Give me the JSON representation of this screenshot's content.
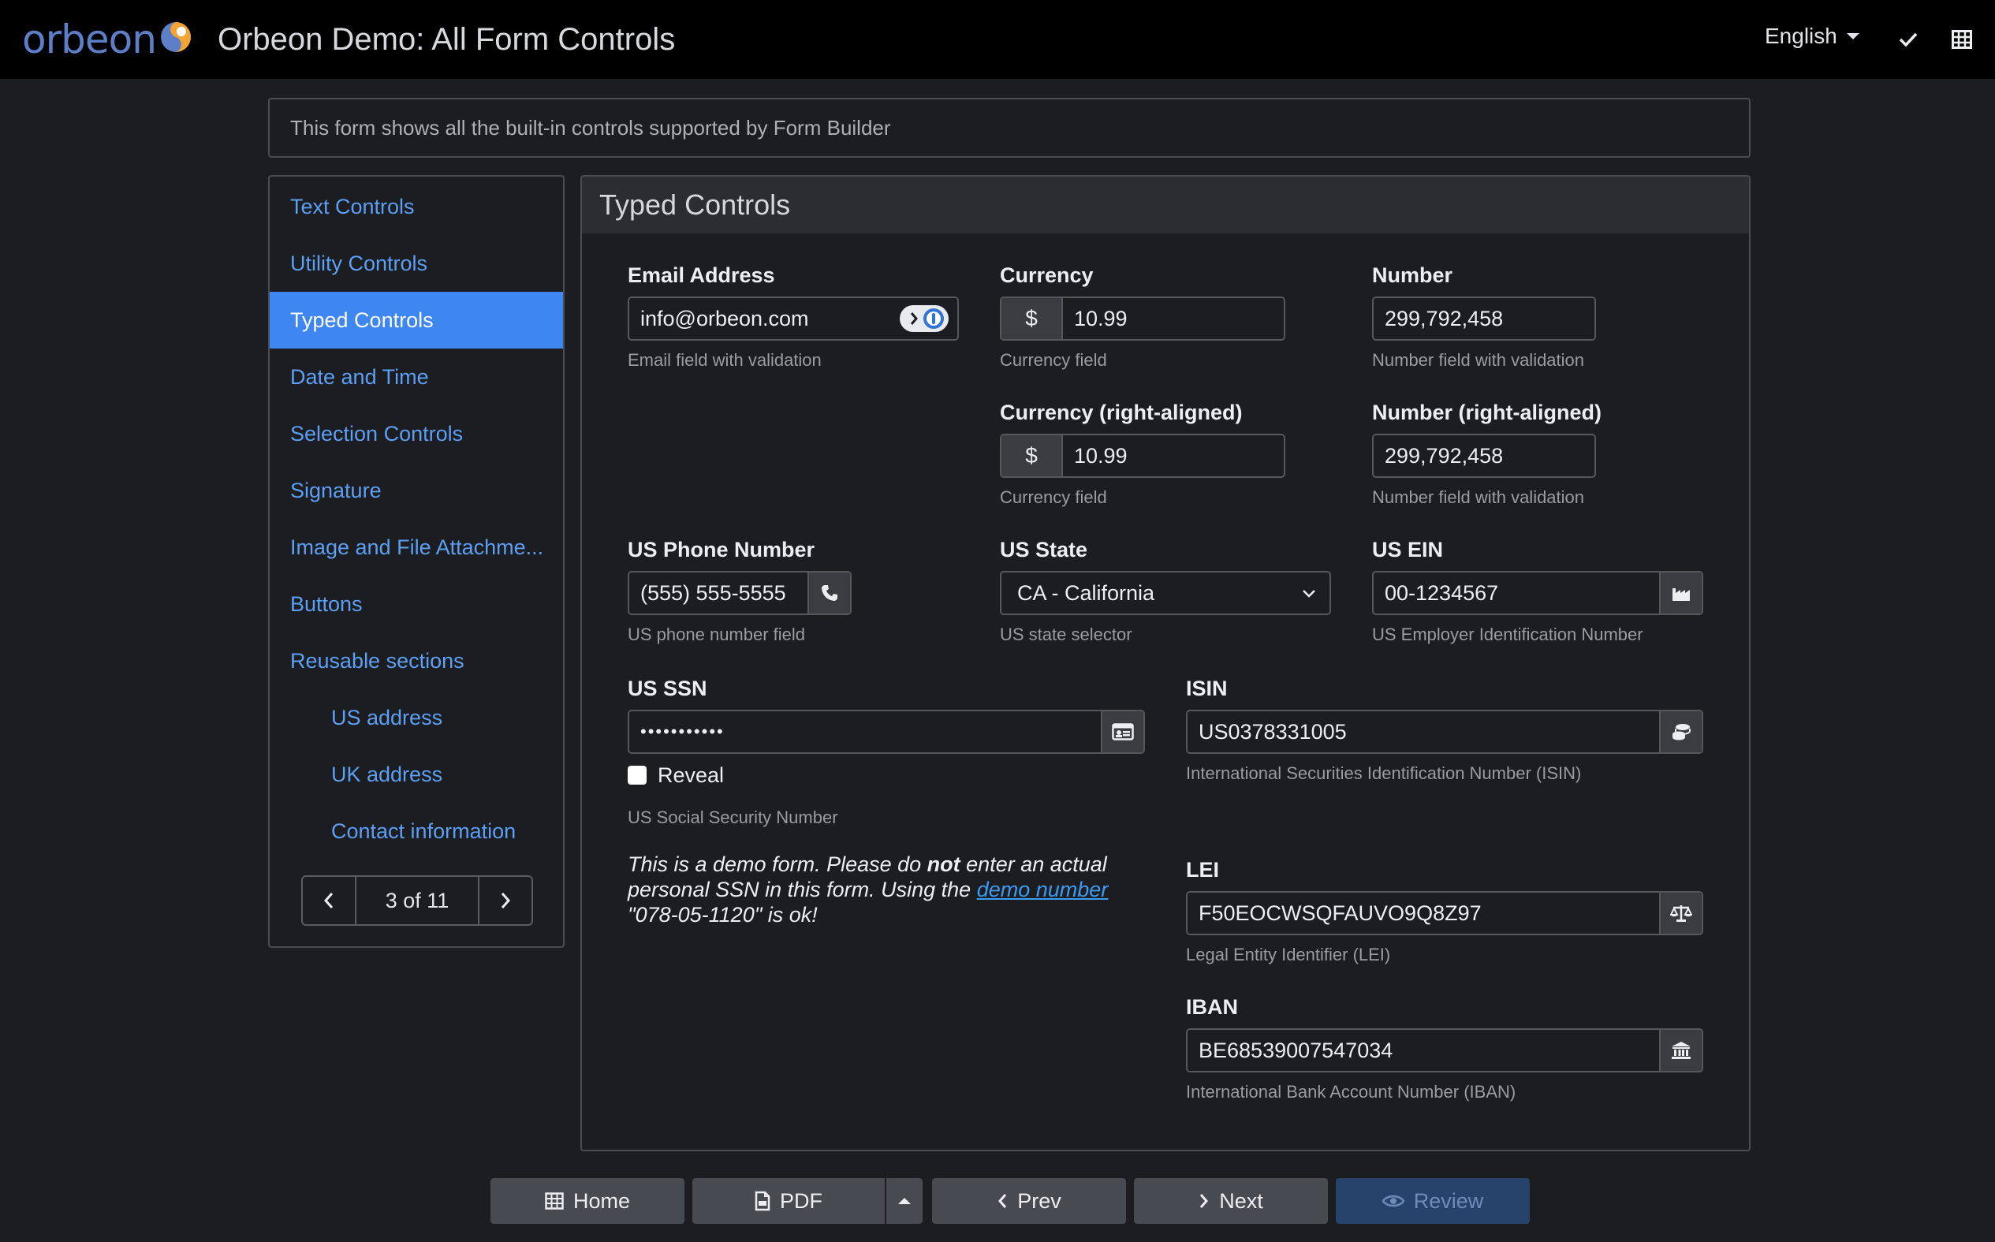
{
  "header": {
    "logo_text": "orbeon",
    "title": "Orbeon Demo: All Form Controls",
    "language": "English"
  },
  "description": "This form shows all the built-in controls supported by Form Builder",
  "sidebar": {
    "items": [
      {
        "label": "Text Controls"
      },
      {
        "label": "Utility Controls"
      },
      {
        "label": "Typed Controls"
      },
      {
        "label": "Date and Time"
      },
      {
        "label": "Selection Controls"
      },
      {
        "label": "Signature"
      },
      {
        "label": "Image and File Attachme..."
      },
      {
        "label": "Buttons"
      },
      {
        "label": "Reusable sections"
      },
      {
        "label": "US address"
      },
      {
        "label": "UK address"
      },
      {
        "label": "Contact information"
      }
    ],
    "active_index": 2,
    "pager": "3 of 11"
  },
  "section": {
    "title": "Typed Controls",
    "email": {
      "label": "Email Address",
      "value": "info@orbeon.com",
      "hint": "Email field with validation"
    },
    "currency": {
      "label": "Currency",
      "symbol": "$",
      "value": "10.99",
      "hint": "Currency field"
    },
    "number": {
      "label": "Number",
      "value": "299,792,458",
      "hint": "Number field with validation"
    },
    "currency_right": {
      "label": "Currency (right-aligned)",
      "symbol": "$",
      "value": "10.99",
      "hint": "Currency field"
    },
    "number_right": {
      "label": "Number (right-aligned)",
      "value": "299,792,458",
      "hint": "Number field with validation"
    },
    "phone": {
      "label": "US Phone Number",
      "value": "(555) 555-5555",
      "hint": "US phone number field"
    },
    "state": {
      "label": "US State",
      "value": "CA - California",
      "hint": "US state selector"
    },
    "ein": {
      "label": "US EIN",
      "value": "00-1234567",
      "hint": "US Employer Identification Number"
    },
    "ssn": {
      "label": "US SSN",
      "value": "•••••••••••",
      "reveal_label": "Reveal",
      "hint": "US Social Security Number"
    },
    "ssn_note": {
      "part1": "This is a demo form. Please do ",
      "bold": "not",
      "part2": " enter an actual personal SSN in this form. Using the ",
      "link": "demo number",
      "part3": " \"078-05-1120\" is ok!"
    },
    "isin": {
      "label": "ISIN",
      "value": "US0378331005",
      "hint": "International Securities Identification Number (ISIN)"
    },
    "lei": {
      "label": "LEI",
      "value": "F50EOCWSQFAUVO9Q8Z97",
      "hint": "Legal Entity Identifier (LEI)"
    },
    "iban": {
      "label": "IBAN",
      "value": "BE68539007547034",
      "hint": "International Bank Account Number (IBAN)"
    }
  },
  "buttons": {
    "home": "Home",
    "pdf": "PDF",
    "prev": "Prev",
    "next": "Next",
    "review": "Review"
  },
  "colors": {
    "accent": "#3e86f2",
    "link": "#5b9ff6",
    "background": "#1c1d20"
  }
}
